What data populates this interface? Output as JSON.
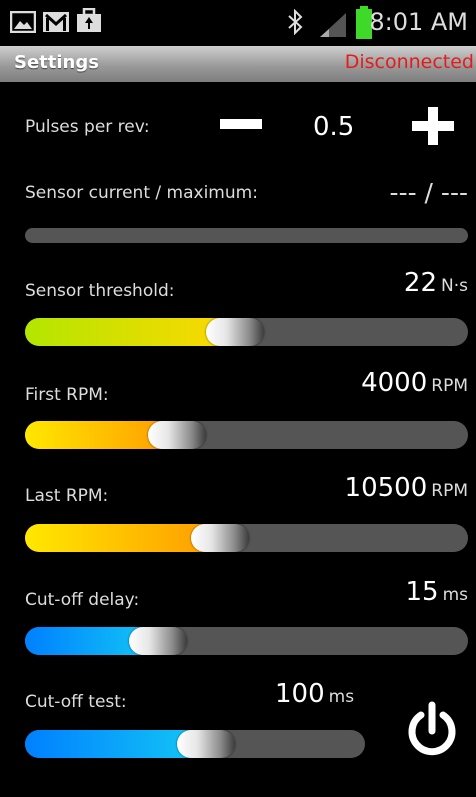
{
  "status_bar": {
    "left_icons": [
      "gallery-icon",
      "gmail-icon",
      "briefcase-icon"
    ],
    "right_icons": [
      "bluetooth-icon",
      "signal-icon",
      "battery-icon"
    ],
    "time": "8:01 AM"
  },
  "action_bar": {
    "title": "Settings",
    "connection_status": "Disconnected",
    "status_color": "#e51c1c"
  },
  "pulses": {
    "label": "Pulses per rev:",
    "value": "0.5",
    "decrement_icon": "minus-icon",
    "increment_icon": "plus-icon"
  },
  "sensor_current": {
    "label": "Sensor current / maximum:",
    "value": "--- / ---"
  },
  "sensor_threshold": {
    "label": "Sensor threshold:",
    "value": "22",
    "unit": "N·s",
    "level_percent": 47
  },
  "first_rpm": {
    "label": "First RPM:",
    "value": "4000",
    "unit": "RPM",
    "level_percent": 32
  },
  "last_rpm": {
    "label": "Last RPM:",
    "value": "10500",
    "unit": "RPM",
    "level_percent": 43
  },
  "cutoff_delay": {
    "label": "Cut-off delay:",
    "value": "15",
    "unit": "ms",
    "level_percent": 27
  },
  "cutoff_test": {
    "label": "Cut-off test:",
    "value": "100",
    "unit": "ms",
    "level_percent": 54,
    "button_icon": "power-icon"
  },
  "colors": {
    "threshold_gradient": [
      "#b3e600",
      "#ffd800"
    ],
    "rpm_gradient": [
      "#ffe800",
      "#ff9a00"
    ],
    "delay_gradient": [
      "#0080ff",
      "#14c8f5"
    ]
  }
}
